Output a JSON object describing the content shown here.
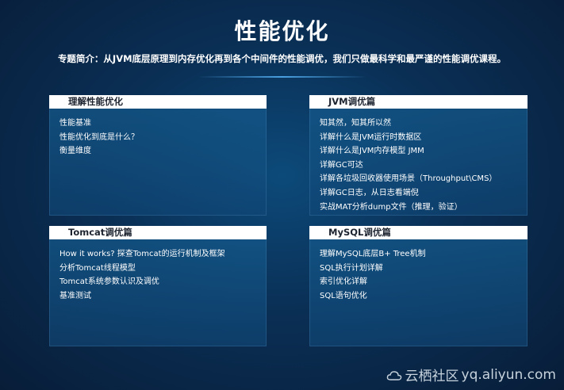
{
  "title": "性能优化",
  "intro": "专题简介：从JVM底层原理到内存优化再到各个中间件的性能调优，我们只做最科学和最严谨的性能调优课程。",
  "panels": [
    {
      "header": "理解性能优化",
      "items": [
        "性能基准",
        "性能优化到底是什么？",
        "衡量维度"
      ]
    },
    {
      "header": "JVM调优篇",
      "items": [
        "知其然，知其所以然",
        "详解什么是JVM运行时数据区",
        "详解什么是JVM内存模型 JMM",
        "详解GC可达",
        "详解各垃圾回收器使用场景（Throughput\\CMS）",
        "详解GC日志，从日志看端倪",
        "实战MAT分析dump文件（推理，验证）"
      ]
    },
    {
      "header": "Tomcat调优篇",
      "items": [
        "How it works? 探查Tomcat的运行机制及框架",
        "分析Tomcat线程模型",
        "Tomcat系统参数认识及调优",
        "基准测试"
      ]
    },
    {
      "header": "MySQL调优篇",
      "items": [
        "理解MySQL底层B+ Tree机制",
        "SQL执行计划详解",
        "索引优化详解",
        "SQL语句优化"
      ]
    }
  ],
  "watermark": {
    "brand": "云栖社区",
    "domain": "yq.aliyun.com",
    "icon": "cloud-icon"
  }
}
